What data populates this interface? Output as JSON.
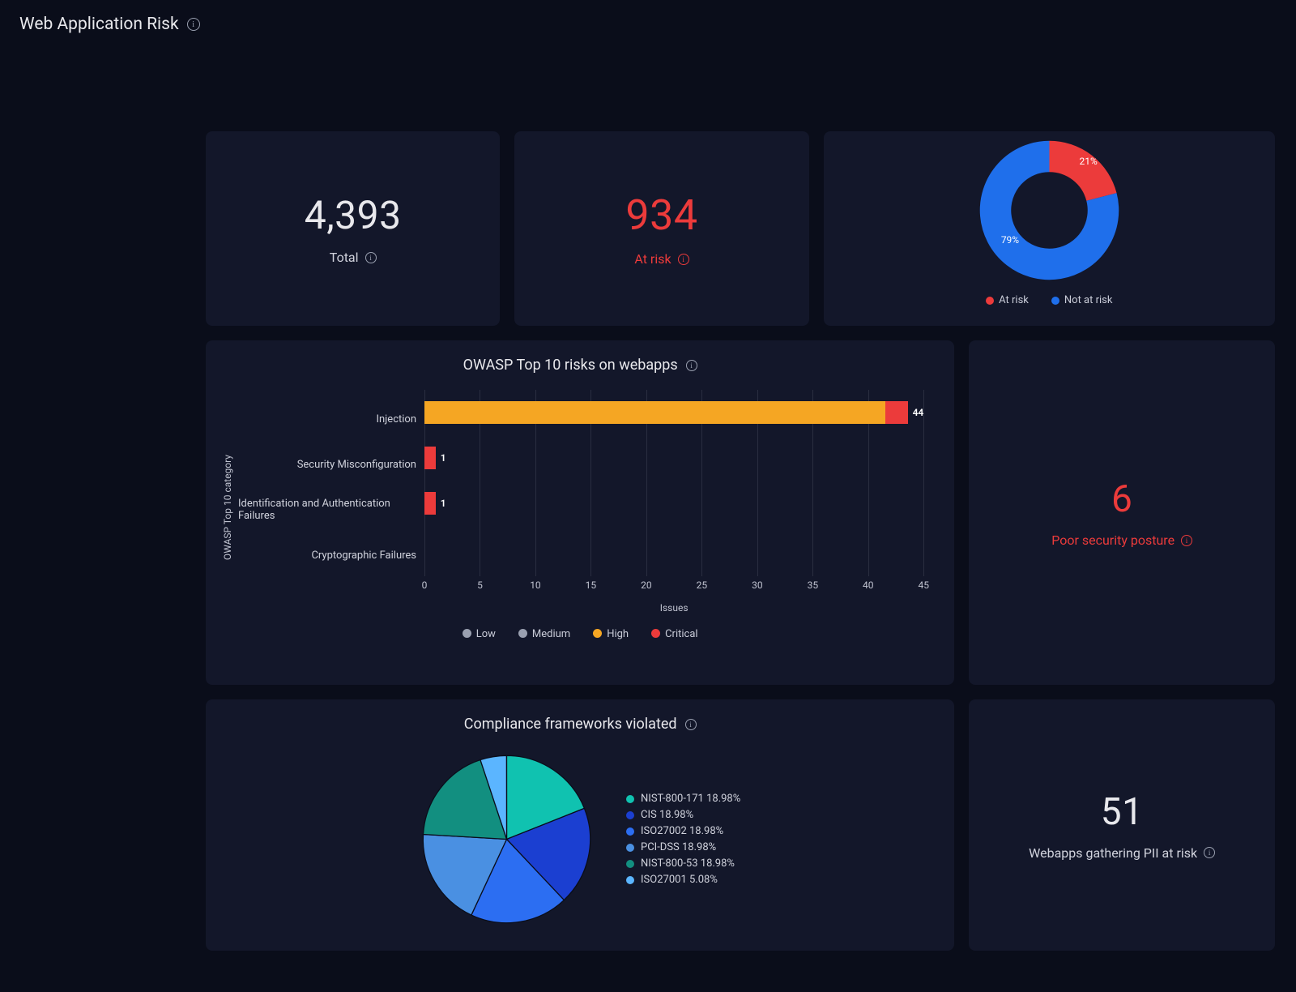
{
  "page_title": "Web Application Risk",
  "colors": {
    "red": "#ec3b3b",
    "blue": "#1f6feb",
    "orange": "#f5a623",
    "grey": "#9aa0b0",
    "teal1": "#10c2b0",
    "teal2": "#21d4e0",
    "blue_deep": "#1b3fd1",
    "blue_mid": "#2c6ef2",
    "blue_light": "#4a90e2",
    "teal_dark": "#128f80",
    "blue_sky": "#5bb5ff"
  },
  "kpis": {
    "total": {
      "value": "4,393",
      "label": "Total"
    },
    "at_risk": {
      "value": "934",
      "label": "At risk"
    },
    "poor_posture": {
      "value": "6",
      "label": "Poor security posture"
    },
    "pii": {
      "value": "51",
      "label": "Webapps gathering PII at risk"
    }
  },
  "donut": {
    "at_risk_pct": 21,
    "not_at_risk_pct": 79,
    "legend_at_risk": "At risk",
    "legend_not_at_risk": "Not at risk"
  },
  "owasp_chart": {
    "title": "OWASP Top 10 risks on webapps",
    "y_axis_label": "OWASP Top 10 category",
    "x_axis_label": "Issues",
    "x_ticks": [
      0,
      5,
      10,
      15,
      20,
      25,
      30,
      35,
      40,
      45
    ],
    "categories": [
      {
        "name": "Injection",
        "value": 44,
        "segments": [
          {
            "sev": "high",
            "count": 42
          },
          {
            "sev": "critical",
            "count": 2
          }
        ]
      },
      {
        "name": "Security Misconfiguration",
        "value": 1,
        "segments": [
          {
            "sev": "critical",
            "count": 1
          }
        ]
      },
      {
        "name": "Identification and Authentication Failures",
        "value": 1,
        "segments": [
          {
            "sev": "critical",
            "count": 1
          }
        ]
      },
      {
        "name": "Cryptographic Failures",
        "value": 0,
        "segments": []
      }
    ],
    "legend": [
      "Low",
      "Medium",
      "High",
      "Critical"
    ]
  },
  "compliance_chart": {
    "title": "Compliance frameworks violated",
    "slices": [
      {
        "label": "NIST-800-171",
        "pct": 18.98,
        "color_key": "teal1"
      },
      {
        "label": "CIS",
        "pct": 18.98,
        "color_key": "blue_deep"
      },
      {
        "label": "ISO27002",
        "pct": 18.98,
        "color_key": "blue_mid"
      },
      {
        "label": "PCI-DSS",
        "pct": 18.98,
        "color_key": "blue_light"
      },
      {
        "label": "NIST-800-53",
        "pct": 18.98,
        "color_key": "teal_dark"
      },
      {
        "label": "ISO27001",
        "pct": 5.08,
        "color_key": "blue_sky"
      }
    ]
  },
  "chart_data": [
    {
      "type": "pie",
      "title": "At-risk donut",
      "series": [
        {
          "name": "At risk",
          "values": [
            21
          ]
        },
        {
          "name": "Not at risk",
          "values": [
            79
          ]
        }
      ]
    },
    {
      "type": "bar",
      "orientation": "horizontal",
      "title": "OWASP Top 10 risks on webapps",
      "xlabel": "Issues",
      "ylabel": "OWASP Top 10 category",
      "categories": [
        "Injection",
        "Security Misconfiguration",
        "Identification and Authentication Failures",
        "Cryptographic Failures"
      ],
      "values": [
        44,
        1,
        1,
        0
      ],
      "xlim": [
        0,
        45
      ],
      "legend": [
        "Low",
        "Medium",
        "High",
        "Critical"
      ]
    },
    {
      "type": "pie",
      "title": "Compliance frameworks violated",
      "series": [
        {
          "name": "NIST-800-171",
          "values": [
            18.98
          ]
        },
        {
          "name": "CIS",
          "values": [
            18.98
          ]
        },
        {
          "name": "ISO27002",
          "values": [
            18.98
          ]
        },
        {
          "name": "PCI-DSS",
          "values": [
            18.98
          ]
        },
        {
          "name": "NIST-800-53",
          "values": [
            18.98
          ]
        },
        {
          "name": "ISO27001",
          "values": [
            5.08
          ]
        }
      ]
    }
  ]
}
